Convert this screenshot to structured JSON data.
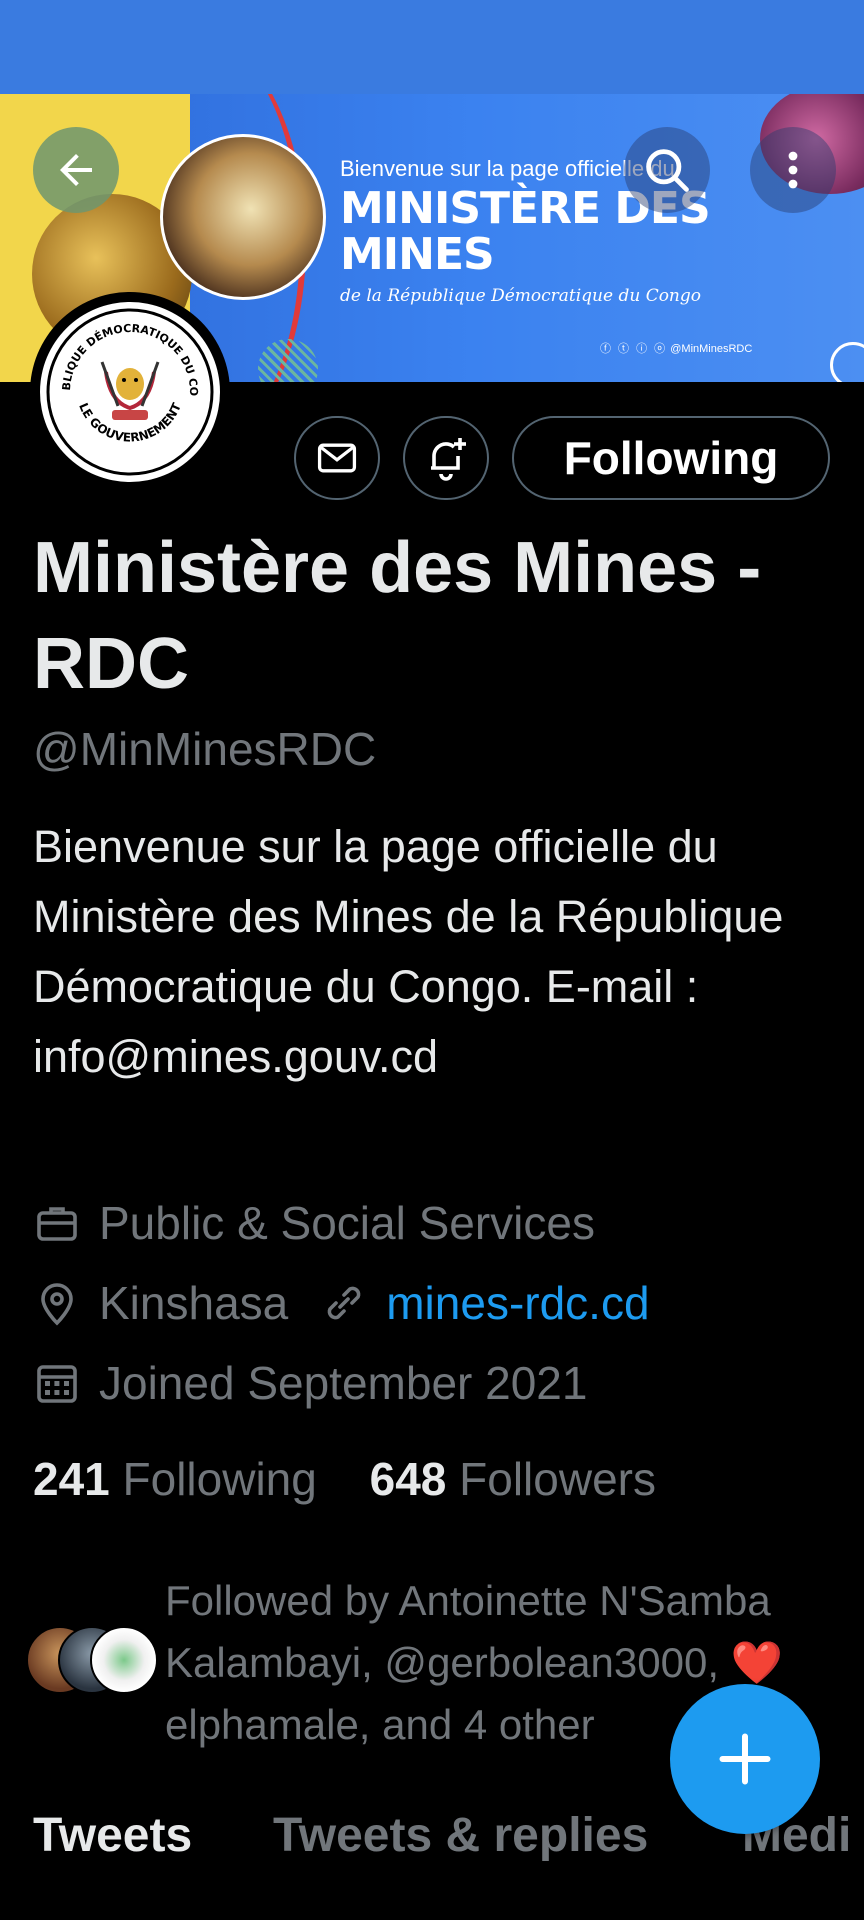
{
  "banner": {
    "welcome": "Bienvenue sur la page officielle du",
    "title_line1": "MINISTÈRE DES",
    "title_line2": "MINES",
    "subtitle": "de la République Démocratique du Congo",
    "social_handle": "@MinMinesRDC"
  },
  "header_buttons": {
    "back": "arrow-left-icon",
    "search": "search-icon",
    "more": "more-vertical-icon"
  },
  "avatar": {
    "seal_top": "RÉPUBLIQUE DÉMOCRATIQUE DU CONGO",
    "seal_bottom": "LE GOUVERNEMENT"
  },
  "actions": {
    "message_icon": "mail-icon",
    "notify_icon": "bell-plus-icon",
    "following_label": "Following"
  },
  "profile": {
    "name": "Ministère des Mines - RDC",
    "handle": "@MinMinesRDC",
    "bio": "Bienvenue sur la page officielle du Ministère des Mines de la République Démocratique du Congo. E-mail : info@mines.gouv.cd",
    "category": "Public & Social Services",
    "location": "Kinshasa",
    "website": "mines-rdc.cd",
    "joined": "Joined September 2021",
    "following_count": "241",
    "following_label": "Following",
    "followers_count": "648",
    "followers_label": "Followers"
  },
  "followed_by": {
    "text": "Followed by Antoinette N'Samba Kalambayi, @gerbolean3000, ❤️elphamale, and 4 other"
  },
  "fab": {
    "icon": "plus-icon"
  },
  "tabs": [
    "Tweets",
    "Tweets & replies",
    "Medi"
  ],
  "colors": {
    "accent": "#1d9bf0",
    "background": "#000000",
    "status_bar": "#3a7be0",
    "muted_text": "#71767b"
  }
}
